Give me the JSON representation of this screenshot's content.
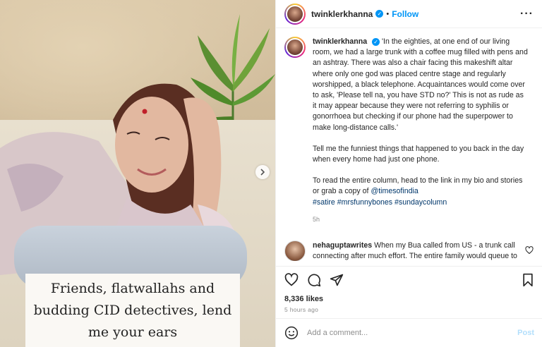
{
  "media": {
    "caption_overlay": "Friends, flatwallahs and budding CID detectives, lend me your ears"
  },
  "header": {
    "username": "twinklerkhanna",
    "separator": "•",
    "follow_label": "Follow",
    "more_icon": "more-horizontal-icon"
  },
  "post": {
    "username": "twinklerkhanna",
    "body": "'In the eighties, at one end of our living room, we had a large trunk with a coffee mug filled with pens and an ashtray. There was also a chair facing this makeshift altar where only one god was placed centre stage and regularly worshipped, a black telephone. Acquaintances would come over to ask, 'Please tell na, you have STD no?' This is not as rude as it may appear because they were not referring to syphilis or gonorrhoea but checking if our phone had the superpower to make long-distance calls.'",
    "para2": "Tell me the funniest things that happened to you back in the day when every home had just one phone.",
    "para3": "To read the entire column, head to the link in my bio and stories or grab a copy of",
    "mention": "@timesofindia",
    "hashtags": "#satire #mrsfunnybones #sundaycolumn",
    "time": "5h"
  },
  "comment": {
    "username": "nehaguptawrites",
    "body": "When my Bua called from US - a trunk call connecting after much effort. The entire family would queue to talk to her. Same questions asked, same answers. How are you! When are you coming? A new birth or a marriage the family extending and shortening. They would scream as if the person"
  },
  "actions": {
    "likes": "8,336 likes",
    "ago": "5 hours ago"
  },
  "add_comment": {
    "placeholder": "Add a comment...",
    "post_label": "Post"
  },
  "colors": {
    "accent": "#0095f6",
    "link": "#00376b",
    "muted": "#8e8e8e"
  }
}
